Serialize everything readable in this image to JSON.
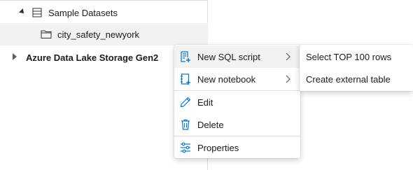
{
  "tree": {
    "items": [
      {
        "label": "Sample Datasets",
        "icon": "database-icon",
        "expanded": true
      },
      {
        "label": "city_safety_newyork",
        "icon": "folder-icon",
        "selected": true
      },
      {
        "label": "Azure Data Lake Storage Gen2",
        "icon": "caret-right-icon",
        "expanded": false
      }
    ]
  },
  "context_menu": {
    "items": [
      {
        "label": "New SQL script",
        "icon": "sql-script-icon",
        "has_submenu": true,
        "highlighted": true
      },
      {
        "label": "New notebook",
        "icon": "notebook-icon",
        "has_submenu": true
      },
      {
        "label": "Edit",
        "icon": "pencil-icon"
      },
      {
        "label": "Delete",
        "icon": "trash-icon"
      },
      {
        "label": "Properties",
        "icon": "sliders-icon"
      }
    ]
  },
  "submenu": {
    "items": [
      {
        "label": "Select TOP 100 rows"
      },
      {
        "label": "Create external table"
      }
    ]
  },
  "colors": {
    "accent": "#0078d4",
    "hover_bg": "#f3f2f1",
    "divider": "#e1dfdd"
  }
}
